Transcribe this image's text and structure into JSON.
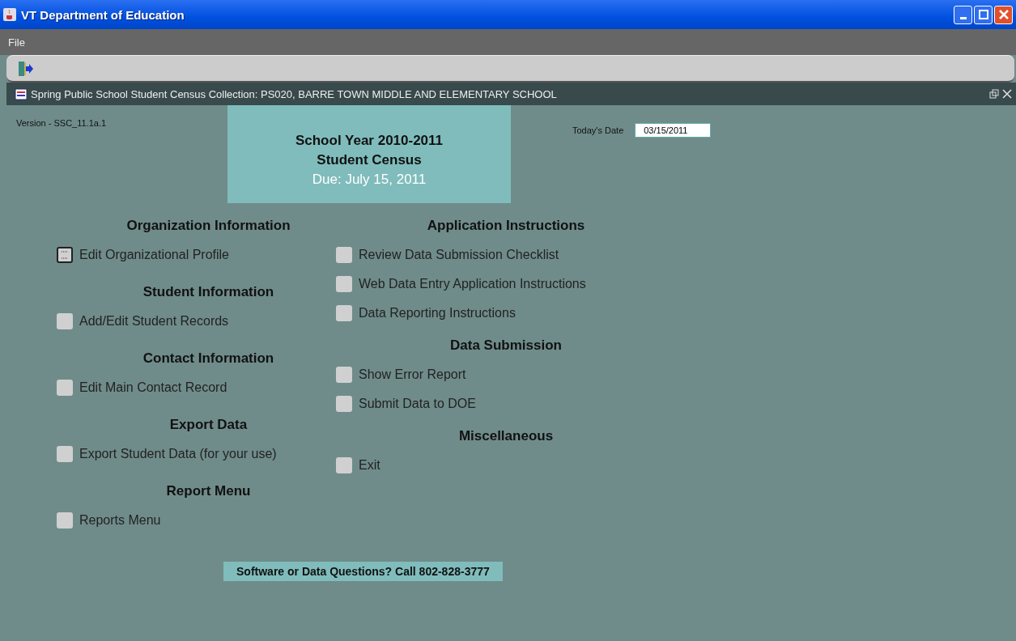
{
  "window": {
    "title": "VT Department of Education"
  },
  "menu_bar": [
    "File"
  ],
  "internal_frame": {
    "title": "Spring Public School Student Census Collection: PS020, BARRE TOWN MIDDLE AND ELEMENTARY SCHOOL"
  },
  "version": "Version - SSC_11.1a.1",
  "banner": {
    "lines": [
      "School Year 2010-2011",
      "Student Census"
    ],
    "due": "Due:  July 15, 2011"
  },
  "date": {
    "label": "Today's Date",
    "value": "03/15/2011"
  },
  "left_sections": [
    {
      "heading": "Organization Information",
      "items": [
        {
          "label": "Edit Organizational Profile",
          "focused": true
        }
      ]
    },
    {
      "heading": "Student Information",
      "items": [
        {
          "label": "Add/Edit Student Records",
          "focused": false
        }
      ]
    },
    {
      "heading": "Contact Information",
      "items": [
        {
          "label": "Edit Main Contact Record",
          "focused": false
        }
      ]
    },
    {
      "heading": "Export Data",
      "items": [
        {
          "label": "Export Student Data (for your use)",
          "focused": false
        }
      ]
    },
    {
      "heading": "Report Menu",
      "items": [
        {
          "label": "Reports Menu",
          "focused": false
        }
      ]
    }
  ],
  "right_sections": [
    {
      "heading": "Application Instructions",
      "items": [
        {
          "label": "Review Data Submission Checklist",
          "focused": false
        },
        {
          "label": "Web Data Entry Application Instructions",
          "focused": false
        },
        {
          "label": "Data Reporting Instructions",
          "focused": false
        }
      ]
    },
    {
      "heading": "Data Submission",
      "items": [
        {
          "label": "Show Error Report",
          "focused": false
        },
        {
          "label": "Submit Data to DOE",
          "focused": false
        }
      ]
    },
    {
      "heading": "Miscellaneous",
      "items": [
        {
          "label": "Exit",
          "focused": false
        }
      ]
    }
  ],
  "footer": "Software or Data Questions?  Call 802-828-3777"
}
